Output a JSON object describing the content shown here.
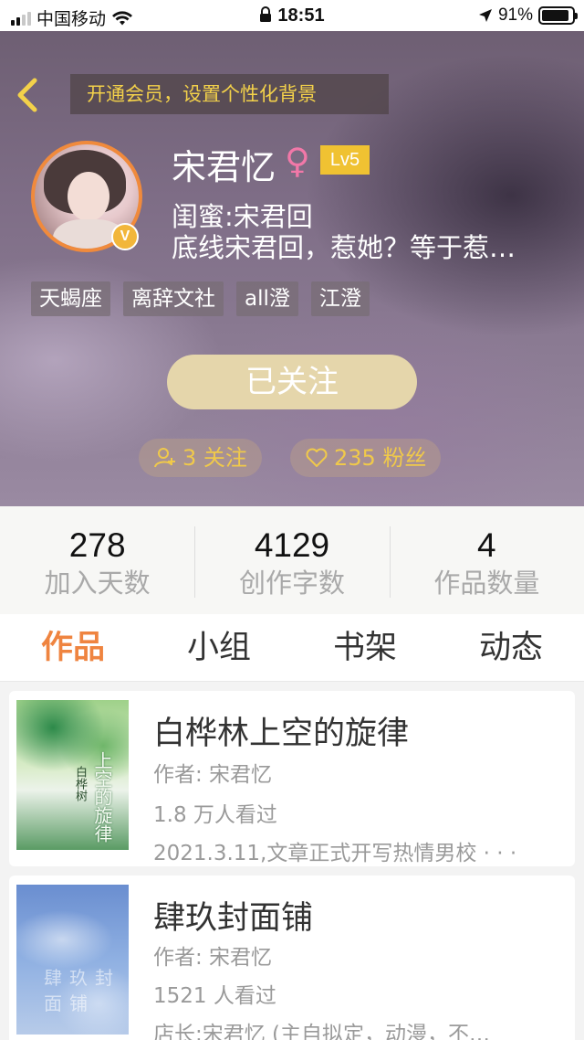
{
  "status_bar": {
    "carrier": "中国移动",
    "time": "18:51",
    "battery": "91%",
    "battery_level": 0.91,
    "icons": [
      "signal-icon",
      "wifi-icon",
      "lock-icon",
      "location-icon",
      "battery-icon"
    ]
  },
  "header": {
    "vip_banner": "开通会员，设置个性化背景",
    "name": "宋君忆",
    "gender_symbol": "♀",
    "level": "Lv5",
    "verified_badge": "V",
    "bio_line1": "闺蜜:宋君回",
    "bio_line2": "底线宋君回，惹她？等于惹…",
    "tags": [
      "天蝎座",
      "离辞文社",
      "all澄",
      "江澄"
    ],
    "follow_button": "已关注",
    "following": "3 关注",
    "followers": "235 粉丝"
  },
  "stats": [
    {
      "value": "278",
      "label": "加入天数"
    },
    {
      "value": "4129",
      "label": "创作字数"
    },
    {
      "value": "4",
      "label": "作品数量"
    }
  ],
  "tabs": [
    "作品",
    "小组",
    "书架",
    "动态"
  ],
  "active_tab": "作品",
  "works": [
    {
      "title": "白桦林上空的旋律",
      "author": "作者: 宋君忆",
      "views": "1.8 万人看过",
      "desc": "2021.3.11,文章正式开写热情男校 · · ·",
      "cover_title": "上空的旋律",
      "cover_sub": "白桦树"
    },
    {
      "title": "肆玖封面铺",
      "author": "作者: 宋君忆",
      "views": "1521 人看过",
      "desc": "店长:宋君忆 (主自拟定，动漫，不…",
      "cover_title": "肆玖封面铺"
    }
  ],
  "colors": {
    "accent": "#ef8440",
    "gold": "#f0c94a",
    "follow_button": "#e5d6ab",
    "level_badge": "#f0c232"
  }
}
